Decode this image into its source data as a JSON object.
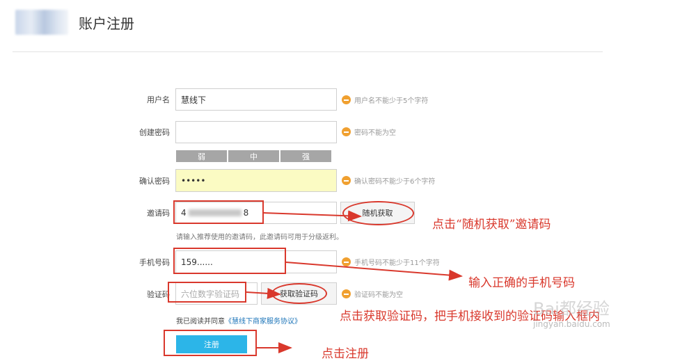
{
  "header": {
    "title": "账户注册"
  },
  "form": {
    "username": {
      "label": "用户名",
      "value": "慧线下",
      "hint": "用户名不能少于5个字符"
    },
    "create_password": {
      "label": "创建密码",
      "value": "",
      "hint": "密码不能为空"
    },
    "strength": {
      "weak": "弱",
      "medium": "中",
      "strong": "强"
    },
    "confirm_password": {
      "label": "确认密码",
      "value": "•••••",
      "hint": "确认密码不能少于6个字符"
    },
    "invite": {
      "label": "邀请码",
      "value_start": "4",
      "value_end": "8",
      "button": "随机获取",
      "note": "请输入推荐使用的邀请码，此邀请码可用于分级返利。"
    },
    "phone": {
      "label": "手机号码",
      "value": "159......",
      "hint": "手机号码不能少于11个字符"
    },
    "verify": {
      "label": "验证码",
      "placeholder": "六位数字验证码",
      "button": "获取验证码",
      "hint": "验证码不能为空"
    },
    "agree": {
      "text": "我已阅读并同意",
      "link": "《慧线下商家服务协议》"
    },
    "submit": {
      "label": "注册"
    }
  },
  "annotations": {
    "invite": "点击“随机获取”邀请码",
    "phone": "输入正确的手机号码",
    "verify": "点击获取验证码，把手机接收到的验证码输入框内",
    "submit": "点击注册"
  },
  "watermark": {
    "brand": "Bai都经验",
    "url": "jingyan.baidu.com"
  },
  "colors": {
    "accent_red": "#d9382c",
    "submit_blue": "#2cb5e8",
    "hint_orange": "#f0a030",
    "yellow_field": "#fbfbc3"
  }
}
